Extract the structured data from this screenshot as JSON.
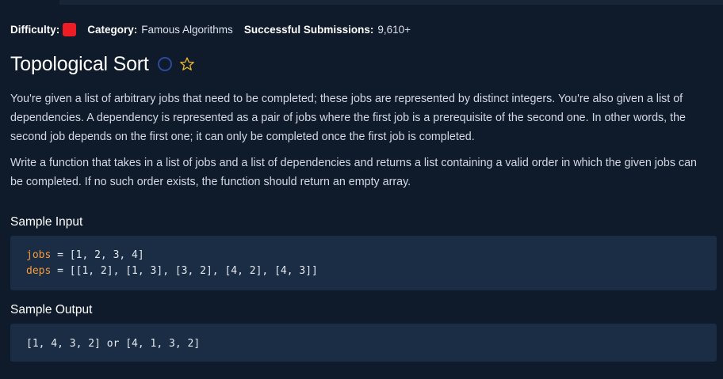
{
  "meta": {
    "difficulty_label": "Difficulty:",
    "difficulty_color": "#ee1c24",
    "category_label": "Category:",
    "category_value": "Famous Algorithms",
    "submissions_label": "Successful Submissions:",
    "submissions_value": "9,610+"
  },
  "problem": {
    "title": "Topological Sort",
    "status_icon": "circle-outline-icon",
    "favorite_icon": "star-outline-icon",
    "paragraphs": [
      "You're given a list of arbitrary jobs that need to be completed; these jobs are represented by distinct integers. You're also given a list of dependencies. A dependency is represented as a pair of jobs where the first job is a prerequisite of the second one. In other words, the second job depends on the first one; it can only be completed once the first job is completed.",
      "Write a function that takes in a list of jobs and a list of dependencies and returns a list containing a valid order in which the given jobs can be completed. If no such order exists, the function should return an empty array."
    ]
  },
  "sample_input": {
    "heading": "Sample Input",
    "lines": [
      {
        "var": "jobs",
        "rest": " = [1, 2, 3, 4]"
      },
      {
        "var": "deps",
        "rest": " = [[1, 2], [1, 3], [3, 2], [4, 2], [4, 3]]"
      }
    ]
  },
  "sample_output": {
    "heading": "Sample Output",
    "text": "[1, 4, 3, 2] or [4, 1, 3, 2]"
  },
  "colors": {
    "background": "#0f1a2b",
    "code_background": "#1b2d45",
    "variable": "#f39a3c",
    "circle_icon": "#2c4a9a",
    "star_icon": "#e9b923"
  }
}
